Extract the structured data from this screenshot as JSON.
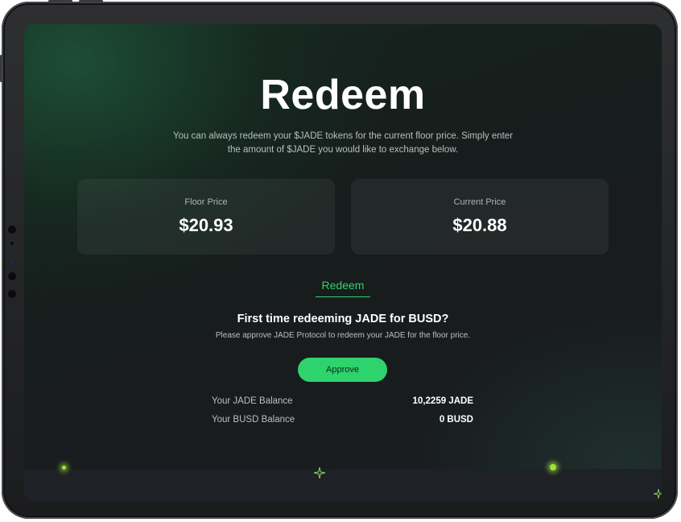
{
  "page": {
    "title": "Redeem",
    "description": "You can always redeem your $JADE tokens for the current floor price. Simply enter the amount of $JADE you would like to exchange below."
  },
  "prices": {
    "floor": {
      "label": "Floor Price",
      "value": "$20.93"
    },
    "current": {
      "label": "Current Price",
      "value": "$20.88"
    }
  },
  "tabs": [
    {
      "label": "Redeem",
      "active": true
    }
  ],
  "approval": {
    "heading": "First time redeeming JADE for BUSD?",
    "note": "Please approve JADE Protocol to redeem your JADE for the floor price.",
    "button_label": "Approve"
  },
  "balances": [
    {
      "label": "Your JADE Balance",
      "value": "10,2259 JADE"
    },
    {
      "label": "Your BUSD Balance",
      "value": "0 BUSD"
    }
  ],
  "colors": {
    "accent": "#2fd36d",
    "background": "#171c1c",
    "card": "#262b2b"
  },
  "decorations": [
    "sparkle-icon",
    "glow-dot-icon"
  ]
}
